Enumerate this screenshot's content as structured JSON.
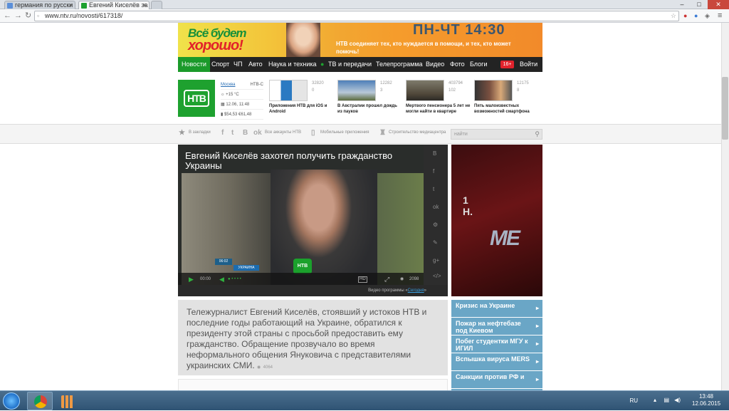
{
  "browser": {
    "tabs": [
      {
        "label": "германия по русски",
        "active": false
      },
      {
        "label": "Евгений Киселёв за",
        "active": true
      }
    ],
    "url": "www.ntv.ru/novosti/617318/"
  },
  "banner": {
    "line1": "Всё будет",
    "line2": "хорошо!",
    "schedule": "ПН-ЧТ 14:30",
    "subtitle": "НТВ соединяет тех, кто нуждается в помощи, и тех, кто может помочь!"
  },
  "nav": {
    "items": [
      "Новости",
      "Спорт",
      "ЧП",
      "Авто",
      "Наука и техника",
      "ТВ и передачи",
      "Телепрограмма",
      "Видео",
      "Фото",
      "Блоги"
    ],
    "age": "16+",
    "login": "Войти"
  },
  "widget": {
    "city": "Москва",
    "channel": "НТВ-С",
    "temp": "+15 °С",
    "datetime": "12.06, 11:48",
    "usd": "$54,53",
    "eur": "€61,48"
  },
  "news_strip": [
    {
      "views": "32820",
      "comments": "0",
      "caption": "Приложения НТВ для iOS и Android"
    },
    {
      "views": "12282",
      "comments": "3",
      "caption": "В Австралии прошел дождь из пауков"
    },
    {
      "views": "403794",
      "comments": "102",
      "caption": "Мертвого пенсионера 5 лет не могли найти в квартире"
    },
    {
      "views": "12175",
      "comments": "8",
      "caption": "Пять малоизвестных возможностей смартфона"
    }
  ],
  "social": {
    "bookmarks": "В закладки",
    "all_accounts": "Все аккаунты НТВ",
    "mobile": "Мобильные приложения",
    "media": "Строительство медиацентра",
    "search_placeholder": "найти"
  },
  "video": {
    "title": "Евгений Киселёв захотел получить гражданство Украины",
    "time_tag": "06:02",
    "country_tag": "УКРАИНА",
    "current_time": "00:00",
    "hd": "HD",
    "views": "2098",
    "source_prefix": "Видео программы «",
    "source_link": "Сегодня",
    "source_suffix": "»"
  },
  "lead": {
    "text": "Тележурналист Евгений Киселёв, стоявший у истоков НТВ и последние годы работающий на Украине, обратился к президенту этой страны с просьбой предоставить ему гражданство. Обращение прозвучало во время неформального общения Януковича с представителями украинских СМИ.",
    "views": "4064"
  },
  "topics": [
    "Кризис на Украине",
    "Пожар на нефтебазе под Киевом",
    "Побег студентки МГУ к ИГИЛ",
    "Вспышка вируса MERS",
    "Санкции против РФ и"
  ],
  "taskbar": {
    "lang": "RU",
    "time": "13:48",
    "date": "12.06.2015"
  }
}
